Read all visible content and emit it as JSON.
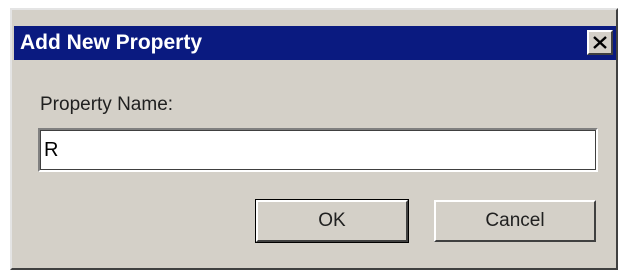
{
  "dialog": {
    "title": "Add New Property",
    "close_icon": "close-icon",
    "field_label": "Property Name:",
    "field_value": "R",
    "ok_label": "OK",
    "cancel_label": "Cancel"
  },
  "colors": {
    "titlebar": "#0a1a80",
    "face": "#d4d0c8",
    "title_text": "#ffffff"
  }
}
